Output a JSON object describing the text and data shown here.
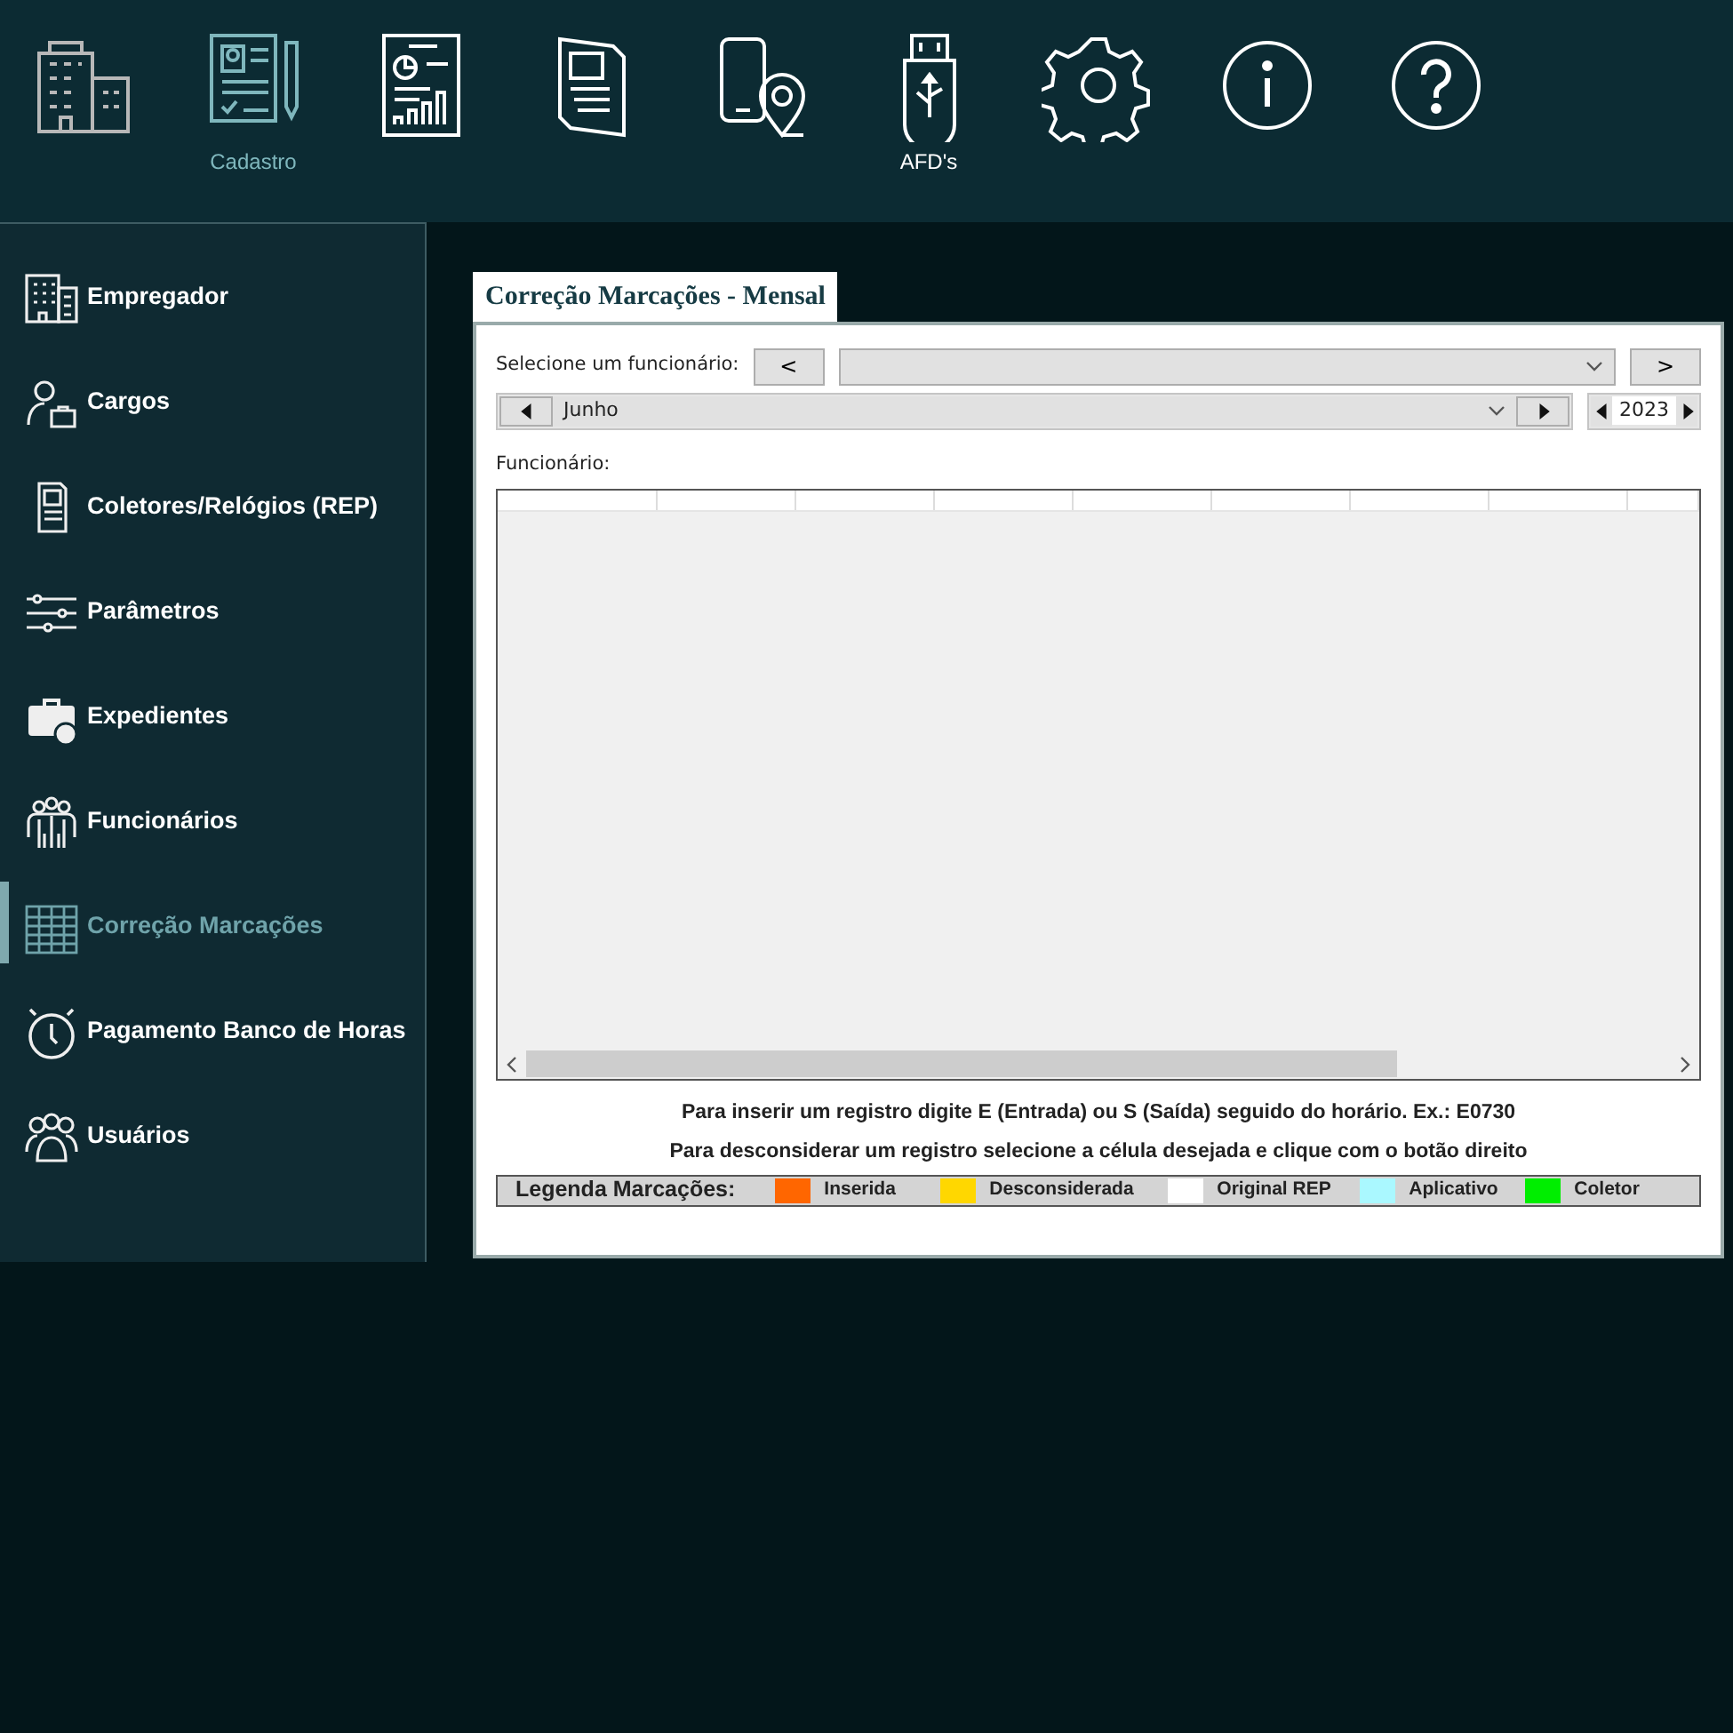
{
  "toolbar": [
    {
      "selected": false
    },
    {
      "label": "Cadastro",
      "selected": true
    },
    {
      "selected": false
    },
    {
      "selected": false
    },
    {
      "selected": false
    },
    {
      "label": "AFD's",
      "selected": false
    },
    {
      "selected": false
    },
    {
      "selected": false
    },
    {
      "selected": false
    }
  ],
  "sidebar": {
    "items": [
      {
        "label": "Empregador",
        "selected": false
      },
      {
        "label": "Cargos",
        "selected": false
      },
      {
        "label": "Coletores/Relógios (REP)",
        "selected": false
      },
      {
        "label": "Parâmetros",
        "selected": false
      },
      {
        "label": "Expedientes",
        "selected": false
      },
      {
        "label": "Funcionários",
        "selected": false
      },
      {
        "label": "Correção Marcações",
        "selected": true
      },
      {
        "label": "Pagamento Banco de Horas",
        "selected": false
      },
      {
        "label": "Usuários",
        "selected": false
      }
    ]
  },
  "panel": {
    "title": "Correção Marcações - Mensal",
    "employee_label": "Selecione um funcionário:",
    "prev_button": "<",
    "next_button": ">",
    "month": "Junho",
    "year": "2023",
    "grid_label": "Funcionário:",
    "hints": [
      "Para inserir um registro digite E (Entrada) ou S (Saída) seguido do horário. Ex.: E0730",
      "Para desconsiderar um registro selecione a célula desejada e clique com o botão direito"
    ],
    "legend": {
      "title": "Legenda Marcações:",
      "items": [
        {
          "label": "Inserida",
          "color": "#ff6600"
        },
        {
          "label": "Desconsiderada",
          "color": "#ffd700"
        },
        {
          "label": "Original REP",
          "color": "#ffffff"
        },
        {
          "label": "Aplicativo",
          "color": "#aaf8ff"
        },
        {
          "label": "Coletor",
          "color": "#00ee00"
        }
      ]
    }
  }
}
